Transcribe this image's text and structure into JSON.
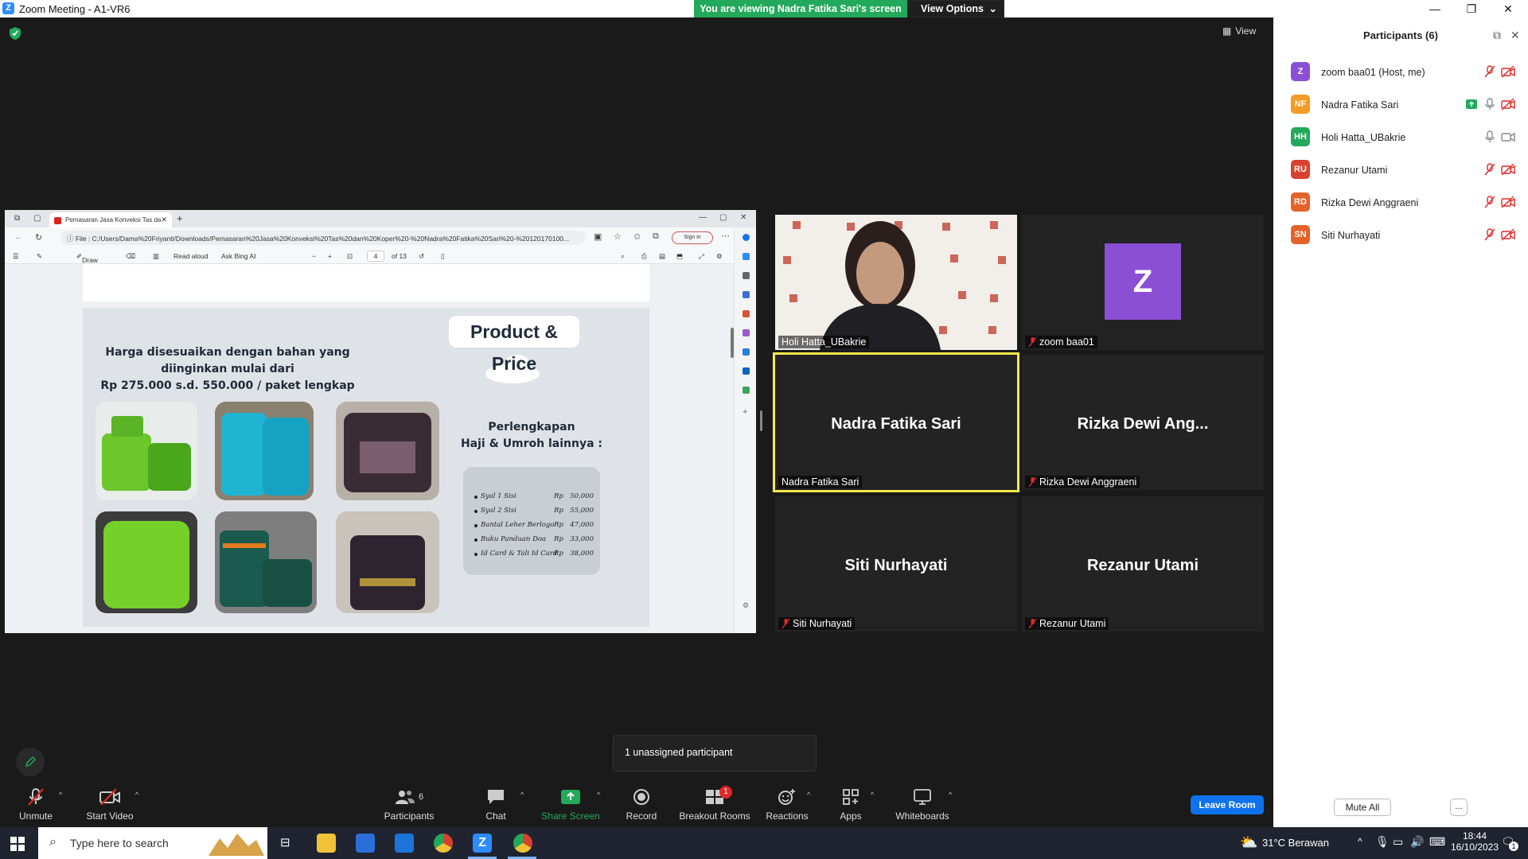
{
  "window": {
    "title": "Zoom Meeting - A1-VR6",
    "app_icon": "Z"
  },
  "share_banner": {
    "text": "You are viewing Nadra Fatika Sari's screen",
    "view_options": "View Options"
  },
  "view_button": "View",
  "browser": {
    "tab_title": "Pemasaran Jasa Konveksi Tas da",
    "url_prefix": "File",
    "url": "C:/Users/Dama%20Friyanti/Downloads/Pemasaran%20Jasa%20Konveksi%20Tas%20dan%20Koper%20-%20Nadra%20Fatika%20Sari%20-%20120170100...",
    "sign_in": "Sign in",
    "toolbar": {
      "draw": "Draw",
      "read_aloud": "Read aloud",
      "ask_bing": "Ask Bing AI",
      "page": "4",
      "page_total": "of 13"
    }
  },
  "slide": {
    "badge": "Product & Price",
    "headline": [
      "Harga disesuaikan dengan bahan yang",
      "diinginkan mulai dari",
      "Rp 275.000 s.d. 550.000 / paket lengkap"
    ],
    "section_title": [
      "Perlengkapan",
      "Haji & Umroh lainnya :"
    ],
    "price_list": [
      {
        "item": "Syal 1 Sisi",
        "currency": "Rp",
        "price": "50,000"
      },
      {
        "item": "Syal 2 Sisi",
        "currency": "Rp",
        "price": "55,000"
      },
      {
        "item": "Bantal Leher Berlogo",
        "currency": "Rp",
        "price": "47,000"
      },
      {
        "item": "Buku Panduan Doa",
        "currency": "Rp",
        "price": "33,000"
      },
      {
        "item": "Id Card & Tali Id Card",
        "currency": "Rp",
        "price": "38,000"
      }
    ]
  },
  "tiles": {
    "holi": {
      "label": "Holi Hatta_UBakrie"
    },
    "zoom": {
      "label": "zoom baa01",
      "avatar": "Z"
    },
    "nadra": {
      "name": "Nadra Fatika Sari",
      "label": "Nadra Fatika Sari"
    },
    "rizka": {
      "name": "Rizka Dewi Ang...",
      "label": "Rizka Dewi Anggraeni"
    },
    "siti": {
      "name": "Siti Nurhayati",
      "label": "Siti Nurhayati"
    },
    "rezanur": {
      "name": "Rezanur Utami",
      "label": "Rezanur Utami"
    }
  },
  "unassigned": "1 unassigned participant",
  "toolbar": {
    "unmute": "Unmute",
    "start_video": "Start Video",
    "participants": "Participants",
    "participants_count": "6",
    "chat": "Chat",
    "share_screen": "Share Screen",
    "record": "Record",
    "breakout_rooms": "Breakout Rooms",
    "breakout_badge": "1",
    "reactions": "Reactions",
    "apps": "Apps",
    "whiteboards": "Whiteboards",
    "leave_room": "Leave Room"
  },
  "panel": {
    "title": "Participants (6)",
    "participants": [
      {
        "initials": "Z",
        "name": "zoom baa01 (Host, me)",
        "color": "#8b4fd6"
      },
      {
        "initials": "NF",
        "name": "Nadra Fatika Sari",
        "color": "#f59a23"
      },
      {
        "initials": "HH",
        "name": "Holi Hatta_UBakrie",
        "color": "#23a95c"
      },
      {
        "initials": "RU",
        "name": "Rezanur Utami",
        "color": "#d9412f"
      },
      {
        "initials": "RD",
        "name": "Rizka Dewi Anggraeni",
        "color": "#e5622b"
      },
      {
        "initials": "SN",
        "name": "Siti Nurhayati",
        "color": "#e5622b"
      }
    ],
    "mute_all": "Mute All",
    "more": "..."
  },
  "taskbar": {
    "search_placeholder": "Type here to search",
    "weather": "31°C  Berawan",
    "time": "18:44",
    "date": "16/10/2023",
    "notification_count": "1"
  },
  "colors": {
    "accent": "#0e72ed",
    "share_green": "#23a95c",
    "active_speaker": "#f3e94a",
    "mute_red": "#e02828"
  }
}
